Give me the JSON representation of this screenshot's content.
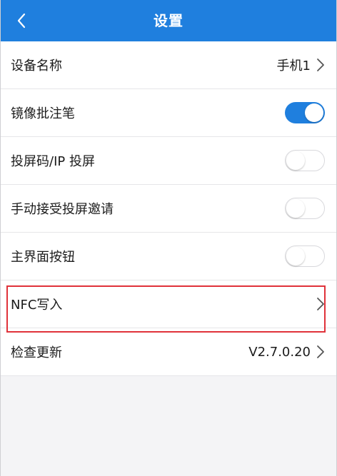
{
  "header": {
    "title": "设置",
    "back_icon": "chevron-left-icon",
    "background_color": "#1f7fde"
  },
  "settings": {
    "items": [
      {
        "label": "设备名称",
        "type": "link",
        "value": "手机1",
        "icon": "chevron-right-icon"
      },
      {
        "label": "镜像批注笔",
        "type": "toggle",
        "checked": true
      },
      {
        "label": "投屏码/IP 投屏",
        "type": "toggle",
        "checked": false
      },
      {
        "label": "手动接受投屏邀请",
        "type": "toggle",
        "checked": false
      },
      {
        "label": "主界面按钮",
        "type": "toggle",
        "checked": false
      },
      {
        "label": "NFC写入",
        "type": "link",
        "value": "",
        "icon": "chevron-right-icon",
        "highlighted": true
      },
      {
        "label": "检查更新",
        "type": "link",
        "value": "V2.7.0.20",
        "icon": "chevron-right-icon"
      }
    ]
  },
  "highlight_color": "#e0323a"
}
